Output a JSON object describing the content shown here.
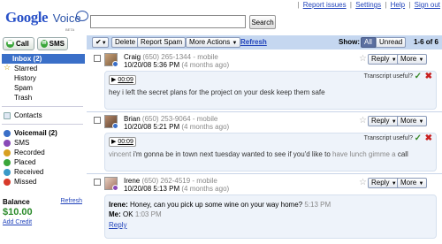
{
  "top_links": [
    "Report issues",
    "Settings",
    "Help",
    "Sign out"
  ],
  "logo": {
    "google": "Google",
    "voice": "Voice",
    "beta": "BETA"
  },
  "search": {
    "button": "Search",
    "value": ""
  },
  "actions": {
    "call": "Call",
    "sms": "SMS"
  },
  "sidebar": {
    "items": [
      {
        "label": "Inbox (2)"
      },
      {
        "label": "Starred"
      },
      {
        "label": "History"
      },
      {
        "label": "Spam"
      },
      {
        "label": "Trash"
      }
    ],
    "contacts": "Contacts",
    "categories": [
      {
        "label": "Voicemail (2)"
      },
      {
        "label": "SMS"
      },
      {
        "label": "Recorded"
      },
      {
        "label": "Placed"
      },
      {
        "label": "Received"
      },
      {
        "label": "Missed"
      }
    ],
    "balance_label": "Balance",
    "balance_refresh": "Refresh",
    "balance_amount": "$10.00",
    "add_credit": "Add Credit"
  },
  "toolbar": {
    "delete": "Delete",
    "report_spam": "Report Spam",
    "more_actions": "More Actions",
    "refresh": "Refresh",
    "show": "Show:",
    "all": "All",
    "unread": "Unread",
    "count": "1-6 of 6"
  },
  "messages": [
    {
      "name": "Craig",
      "phone": "(650) 265-1344",
      "type": "- mobile",
      "time": "10/20/08 5:36 PM",
      "ago": "(4 months ago)",
      "duration": "00:09",
      "transcript_label": "Transcript useful?",
      "transcript_parts": [
        "hey i left the secret plans for the project on your desk keep them safe"
      ]
    },
    {
      "name": "Brian",
      "phone": "(650) 253-9064",
      "type": "- mobile",
      "time": "10/20/08 5:21 PM",
      "ago": "(4 months ago)",
      "duration": "00:09",
      "transcript_label": "Transcript useful?",
      "transcript_parts": [
        "vincent ",
        "i'm gonna be ",
        "in town next tuesday ",
        "wanted to see if you'd like to ",
        "have lunch ",
        "gimme a ",
        "call"
      ]
    },
    {
      "name": "Irene",
      "phone": "(650) 262-4519",
      "type": "- mobile",
      "time": "10/20/08 5:13 PM",
      "ago": "(4 months ago)",
      "sms": [
        {
          "from": "Irene:",
          "text": "Honey, can you pick up some wine on your way home?",
          "time": "5:13 PM"
        },
        {
          "from": "Me:",
          "text": "OK",
          "time": "1:03 PM"
        }
      ],
      "reply_link": "Reply"
    }
  ],
  "buttons": {
    "reply": "Reply",
    "more": "More"
  },
  "colors": {
    "accent": "#3a6fc8",
    "toolbar": "#c5d7f0",
    "balance": "#2a8a2a"
  }
}
